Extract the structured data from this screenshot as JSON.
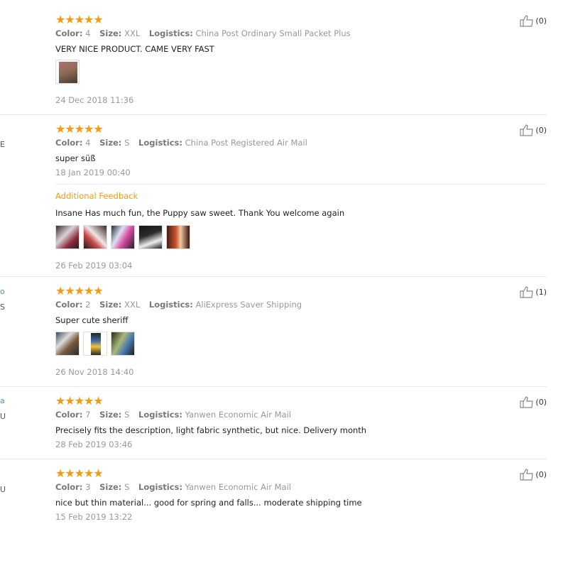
{
  "labels": {
    "color": "Color:",
    "size": "Size:",
    "logistics": "Logistics:",
    "additional_feedback": "Additional Feedback"
  },
  "colors": {
    "star": "#f39c12",
    "link": "#4a90c8"
  },
  "left_edge_fragments": [
    "E",
    "o",
    "S",
    "a",
    "U",
    "U"
  ],
  "reviews": [
    {
      "stars": 5,
      "color": "4",
      "size": "XXL",
      "logistics": "China Post Ordinary Small Packet Plus",
      "text": "VERY NICE PRODUCT. CAME VERY FAST",
      "images": 1,
      "date": "24 Dec 2018 11:36",
      "helpful": "(0)"
    },
    {
      "stars": 5,
      "color": "4",
      "size": "S",
      "logistics": "China Post Registered Air Mail",
      "text": "super süß",
      "date": "18 Jan 2019 00:40",
      "additional": {
        "text": "Insane Has much fun, the Puppy saw sweet. Thank You welcome again",
        "images": 5,
        "date": "26 Feb 2019 03:04"
      },
      "helpful": "(0)"
    },
    {
      "stars": 5,
      "color": "2",
      "size": "XXL",
      "logistics": "AliExpress Saver Shipping",
      "text": "Super cute sheriff",
      "images": 3,
      "date": "26 Nov 2018 14:40",
      "helpful": "(1)"
    },
    {
      "stars": 5,
      "color": "7",
      "size": "S",
      "logistics": "Yanwen Economic Air Mail",
      "text": "Precisely fits the description, light fabric synthetic, but nice. Delivery month",
      "date": "28 Feb 2019 03:46",
      "helpful": "(0)"
    },
    {
      "stars": 5,
      "color": "3",
      "size": "S",
      "logistics": "Yanwen Economic Air Mail",
      "text": "nice but thin material... good for spring and falls... moderate shipping time",
      "date": "15 Feb 2019 13:22",
      "helpful": "(0)"
    }
  ]
}
